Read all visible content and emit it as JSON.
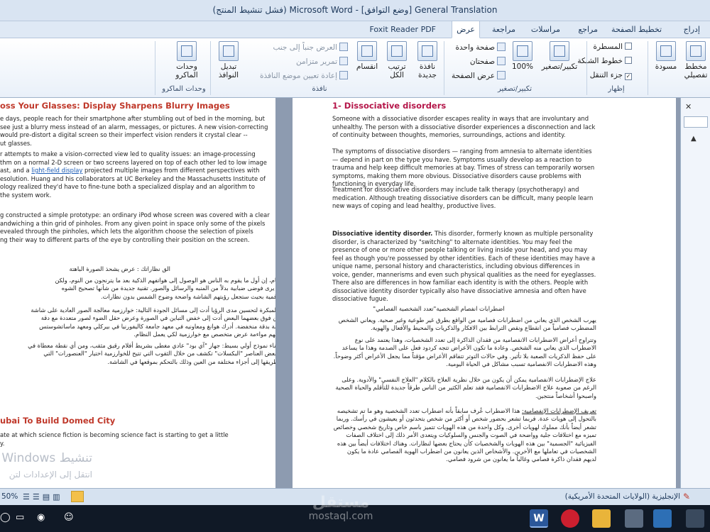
{
  "window": {
    "title": "General Translation [وضع التوافق] - Microsoft Word (فشل تنشيط المنتج)"
  },
  "tabs": [
    {
      "label": "إدراج"
    },
    {
      "label": "تخطيط الصفحة"
    },
    {
      "label": "مراجع"
    },
    {
      "label": "مراسلات"
    },
    {
      "label": "مراجعة"
    },
    {
      "label": "عرض"
    },
    {
      "label": "Foxit Reader PDF"
    }
  ],
  "ribbon": {
    "views": {
      "print_layout": "مخطط تفصيلي",
      "draft": "مسودة",
      "group": ""
    },
    "show": {
      "ruler": "المسطرة",
      "gridlines": "خطوط الشبكة",
      "nav_pane": "جزء التنقل",
      "group": "إظهار"
    },
    "zoom": {
      "zoom": "تكبير/تصغير",
      "percent": "100%",
      "one_page": "صفحة واحدة",
      "two_pages": "صفحتان",
      "page_width": "عرض الصفحة",
      "group": "تكبير/تصغير"
    },
    "window": {
      "new_window": "نافذة جديدة",
      "arrange_all": "ترتيب الكل",
      "split": "انقسام",
      "side_by_side": "العرض جنباً إلى جنب",
      "sync_scroll": "تمرير متزامن",
      "reset_position": "إعادة تعيين موضع النافذة",
      "switch_windows": "تبديل النوافذ",
      "group": "نافذة"
    },
    "macros": {
      "label": "وحدات الماكرو",
      "group": "وحدات الماكرو"
    }
  },
  "left_page": {
    "heading": "oss Your Glasses: Display Sharpens Blurry Images",
    "para1": [
      "e days, people reach for their smartphone after stumbling out of bed in the morning, but",
      "see just a blurry mess instead of an alarm, messages, or pictures. A new vision-correcting",
      "would pre-distort a digital screen so their imperfect vision renders it crystal clear --",
      "ut glasses."
    ],
    "para2": [
      "r attempts to make a vision-corrected view led to quality issues: an image-processing",
      "thm on a normal 2-D screen or two screens layered on top of each other led to low image",
      "ast, and a ",
      "light-field display",
      " projected multiple images from different perspectives with",
      "esolution. Huang and his collaborators at UC Berkeley and the Massachusetts Institute of",
      "ology realized they'd have to fine-tune both a specialized display and an algorithm to",
      " the system work."
    ],
    "para3": [
      "g constructed a simple prototype: an ordinary iPod whose screen was covered with a clear",
      "andwiching a thin grid of pinholes. From any given point in space only some of the pixels",
      "evealed through the pinholes, which lets the algorithm choose the selection of pixels",
      "ng their way to different parts of the eye by controlling their position on the screen."
    ],
    "ar_heading": "الق نظاراتك : عرض يشحذ الصورة الباهتة",
    "ar_para1": [
      "في هذه الأيام، إن أول ما يقوم به الناس هو الوصول إلى هواتفهم الذكية بعد ما يترنحون من النوم، ولكن",
      "العديد منهم يرى فوضى ضبابية بدلاً من المنبه والرسائل والصور. تقنية جديدة من شأنها تصحيح الشوه",
      "الشاشة الرقمية بحيث ستجعل رؤيتهم الشاشة واضحة وضوح الشمس بدون نظارات."
    ],
    "ar_para2": [
      "المحاولات المبكرة لتحسين مدى الرؤيا أدت إلى مسائل الجودة التالية: خوارزمية معالجة الصور العادية على شاشة",
      "٢ أو شاشتين فوق بعضهما البعض أدت إلى خفض التباين في الصورة وعرض حقل الضوء لصور متعددة مع دقة",
      "وزوايا مختلفة بدقة منخفضة. أدرك هوانغ ومعاونيه في معهد جامعة كاليفورنيا في بيركلي ومعهد ماساتشوستس",
      "أنه يجب عليهم مواءمة عرض متخصص مع خوارزمية لكي يعمل النظام."
    ],
    "ar_para3": [
      "قام هوانغ ببناء نموذج أولي بسيط: جهاز \"آي بود\" عادي مغطى بشريط أفلام رقيق مثقب، ومن أي نقطة معطاة في",
      "الفراغ فإن بعض العناصر \"البكسلات\" تكشف من خلال الثقوب التي تتيح للخوارزمية اختيار \"العنصورات\" التي",
      "التي تشق طريقها إلى أجزاء مختلفة من العين وذلك بالتحكم بموقعها في الشاشة."
    ],
    "heading2": "ubai To Build Domed City",
    "para4": [
      "ate at which science fiction is becoming science fact is starting to get a little",
      "y."
    ],
    "activate_title": "تنشيط Windows",
    "activate_sub": "انتقل إلى الإعدادات لتن"
  },
  "right_page": {
    "heading": "1- Dissociative disorders",
    "p1": "Someone with a dissociative disorder escapes reality in ways that are involuntary and unhealthy. The person with a dissociative disorder experiences a disconnection and lack of continuity between thoughts, memories, surroundings, actions and identity.",
    "p2": "The symptoms of dissociative disorders — ranging from amnesia to alternate identities — depend in part on the type you have. Symptoms usually develop as a reaction to trauma and help keep difficult memories at bay. Times of stress can temporarily worsen symptoms, making them more obvious. Dissociative disorders cause problems with functioning in everyday life.",
    "p3": "Treatment for dissociative disorders may include talk therapy (psychotherapy) and medication. Although treating dissociative disorders can be difficult, many people learn new ways of coping and lead healthy, productive lives.",
    "p4_bold": "Dissociative identity disorder.",
    "p4": " This disorder, formerly known as multiple personality disorder, is characterized by \"switching\" to alternate identities. You may feel the presence of one or more other people talking or living inside your head, and you may feel as though you're possessed by other identities. Each of these identities may have a unique name, personal history and characteristics, including obvious differences in voice, gender, mannerisms and even such physical qualities as the need for eyeglasses. There also are differences in how familiar each identity is with the others. People with dissociative identity disorder typically also have dissociative amnesia and often have dissociative fugue.",
    "ar_title": "اضطرابات انفصام الشخصية\"تعدد الشخصية الفصامي\"",
    "ar1": "يهرب الشخص الذي يعاني من اضطرابات فصامية من الواقع بطرق غير طوعية وغير صحية. ويعاني الشخص المضطرب فصامياً من انقطاع ونقص الترابط بين الافكار والذكريات والمحيط والأفعال والهوية.",
    "ar2": "وتتراوح أعراض الاضطرابات الانفصامية من فقدان الذاكرة إلى تعدد الشخصيات، وهذا يعتمد على نوع الاضطراب الذي يعاني منه الشخص. وعادة ما تكون الأعراض تتجه كردود فعل على الصدمة وهذا ما يساعد على حفظ الذكريات الصعبة بلا تأثير. وفي حالات التوتر تتفاقم الأعراض مؤقتاً مما يجعل الأعراض أكثر وضوحاً. وهذه الاضطرابات الانفصامية تسبب مشاكل في الحياة اليومية.",
    "ar3": "علاج الإضطرابات الانفصامية يمكن أن يكون من خلال نظرية العلاج بالكلام \"العلاج النفسي\" والأدوية. وعلى الرغم من صعوبة علاج الاضطرابات الانفصامية فقد تعلم الكثير من الناس طرقاً جديدة للتأقلم والحياة الصحية واصبحوا أشخاصاً منتجين.",
    "ar4_lead": "تعريف الإضطرابات الإنفصامية:",
    "ar4": " هذا الاضطراب عُرف سابقاً بأنه اضطراب تعدد الشخصية وهو ما تم تشخيصه بالتحول إلى هويات عدة. فربما تشعر بحضور شخص أو أكثر من شخص يتحدثون أو يعيشون في رأسك. وربما تشعر أيضاً بأنك مملوك لهويات أخرى. وكل واحدة من هذه الهويات تتميز باسم خاص وتاريخ شخصي وخصائص تميزه مع اختلافات جلية وواضحة في الصوت والجنس والسلوكيات ويتعدى الأمر ذلك إلى اختلاف الصفات الفيزيائية \"الجسمية\" بين هذه الهويات والشخصيات كأن يحتاج بعضها لنظارات. وهناك اختلافات أيضاً بين هذه الشخصيات في تعاملها مع الأخرين. والأشخاص الذين يعانون من اضطراب الهوية الفصامي عادة ما يكون لديهم فقدان ذاكرة فصامي وغالباً ما يعانون من شرود فصامي."
  },
  "status": {
    "zoom": "50%",
    "language": "الإنجليزية (الولايات المتحدة الأمريكية)"
  },
  "watermark": {
    "arabic": "مستقل",
    "latin": "mostaql.com"
  },
  "colors": {
    "accent": "#2b579a",
    "heading_red": "#c0392b",
    "taskbar": "#101926"
  }
}
